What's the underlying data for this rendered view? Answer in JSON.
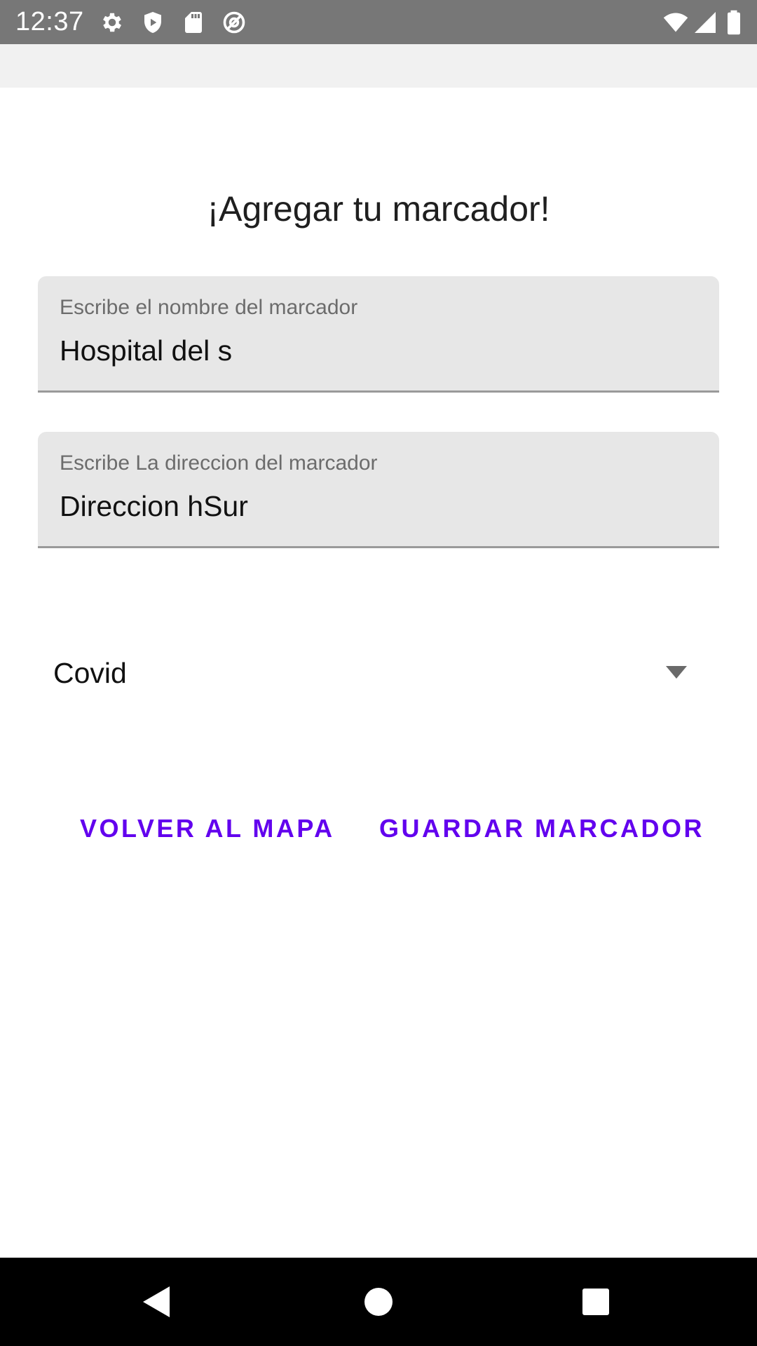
{
  "status_bar": {
    "time": "12:37",
    "icons_left": [
      "settings-icon",
      "shield-icon",
      "sd-card-icon",
      "at-sign-icon"
    ],
    "icons_right": [
      "wifi-icon",
      "signal-icon",
      "battery-icon"
    ],
    "background": "#777777"
  },
  "main": {
    "title": "¡Agregar tu marcador!",
    "name_field": {
      "label": "Escribe el nombre del marcador",
      "value": "Hospital del s"
    },
    "address_field": {
      "label": "Escribe La direccion del marcador",
      "value": "Direccion hSur"
    },
    "category_spinner": {
      "selected": "Covid"
    },
    "buttons": {
      "back_label": "VOLVER AL MAPA",
      "save_label": "GUARDAR MARCADOR"
    }
  },
  "nav_bar": {
    "buttons": [
      "back-icon",
      "home-icon",
      "recents-icon"
    ]
  },
  "colors": {
    "accent": "#6200ee",
    "field_background": "#e7e7e7",
    "app_bar": "#f1f1f1"
  }
}
